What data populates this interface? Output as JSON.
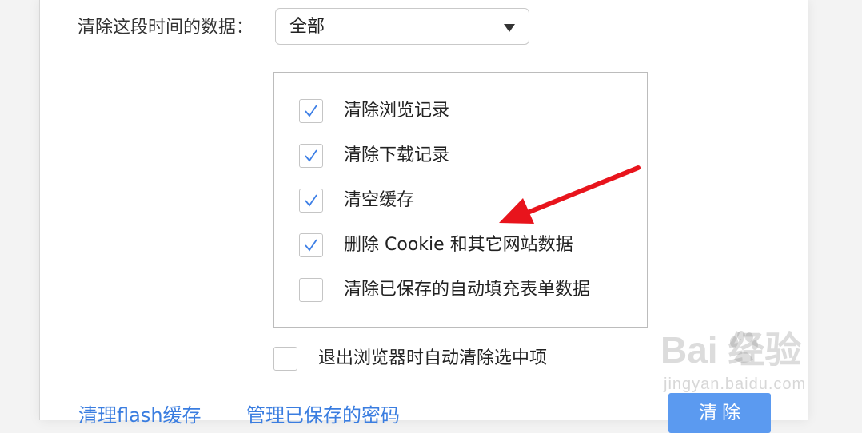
{
  "range": {
    "label": "清除这段时间的数据：",
    "selected": "全部"
  },
  "options": [
    {
      "label": "清除浏览记录",
      "checked": true
    },
    {
      "label": "清除下载记录",
      "checked": true
    },
    {
      "label": "清空缓存",
      "checked": true
    },
    {
      "label": "删除 Cookie 和其它网站数据",
      "checked": true
    },
    {
      "label": "清除已保存的自动填充表单数据",
      "checked": false
    }
  ],
  "exit_option": {
    "label": "退出浏览器时自动清除选中项",
    "checked": false
  },
  "links": {
    "flash_cache": "清理flash缓存",
    "saved_passwords": "管理已保存的密码"
  },
  "buttons": {
    "clear": "清除"
  },
  "watermark": {
    "logo": "Bai  经验",
    "site": "jingyan.baidu.com"
  },
  "colors": {
    "accent": "#3a7de0",
    "button": "#5b9af0",
    "arrow": "#e8141c",
    "check": "#3d7fe6"
  }
}
